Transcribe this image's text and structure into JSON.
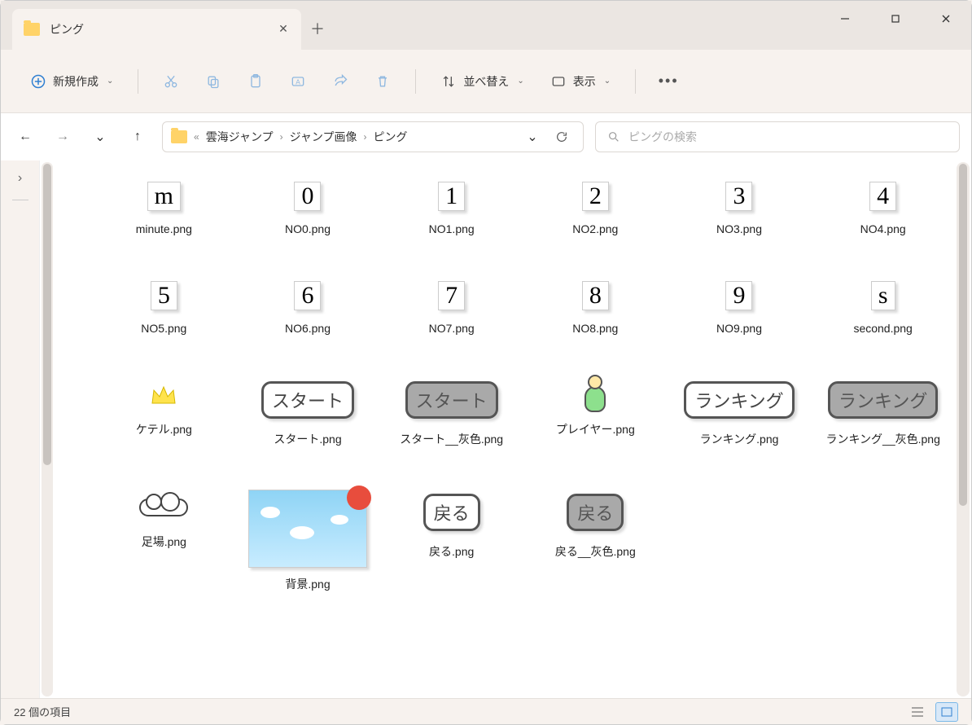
{
  "tab": {
    "title": "ピング"
  },
  "toolbar": {
    "new_label": "新規作成",
    "sort_label": "並べ替え",
    "view_label": "表示"
  },
  "breadcrumb": {
    "prefix": "«",
    "parts": [
      "雲海ジャンプ",
      "ジャンプ画像",
      "ピング"
    ]
  },
  "search": {
    "placeholder": "ピングの検索"
  },
  "files": [
    {
      "label": "minute.png",
      "kind": "char",
      "content": "m"
    },
    {
      "label": "NO0.png",
      "kind": "char",
      "content": "0"
    },
    {
      "label": "NO1.png",
      "kind": "char",
      "content": "1"
    },
    {
      "label": "NO2.png",
      "kind": "char",
      "content": "2"
    },
    {
      "label": "NO3.png",
      "kind": "char",
      "content": "3"
    },
    {
      "label": "NO4.png",
      "kind": "char",
      "content": "4"
    },
    {
      "label": "NO5.png",
      "kind": "char",
      "content": "5"
    },
    {
      "label": "NO6.png",
      "kind": "char",
      "content": "6"
    },
    {
      "label": "NO7.png",
      "kind": "char",
      "content": "7"
    },
    {
      "label": "NO8.png",
      "kind": "char",
      "content": "8"
    },
    {
      "label": "NO9.png",
      "kind": "char",
      "content": "9"
    },
    {
      "label": "second.png",
      "kind": "char",
      "content": "s"
    },
    {
      "label": "ケテル.png",
      "kind": "crown"
    },
    {
      "label": "スタート.png",
      "kind": "btn-white",
      "content": "スタート"
    },
    {
      "label": "スタート__灰色.png",
      "kind": "btn-gray",
      "content": "スタート"
    },
    {
      "label": "プレイヤー.png",
      "kind": "player"
    },
    {
      "label": "ランキング.png",
      "kind": "btn-white",
      "content": "ランキング"
    },
    {
      "label": "ランキング__灰色.png",
      "kind": "btn-gray",
      "content": "ランキング"
    },
    {
      "label": "足場.png",
      "kind": "cloud"
    },
    {
      "label": "背景.png",
      "kind": "sky"
    },
    {
      "label": "戻る.png",
      "kind": "btn-white",
      "content": "戻る"
    },
    {
      "label": "戻る__灰色.png",
      "kind": "btn-gray",
      "content": "戻る"
    }
  ],
  "status": {
    "count_text": "22 個の項目"
  }
}
